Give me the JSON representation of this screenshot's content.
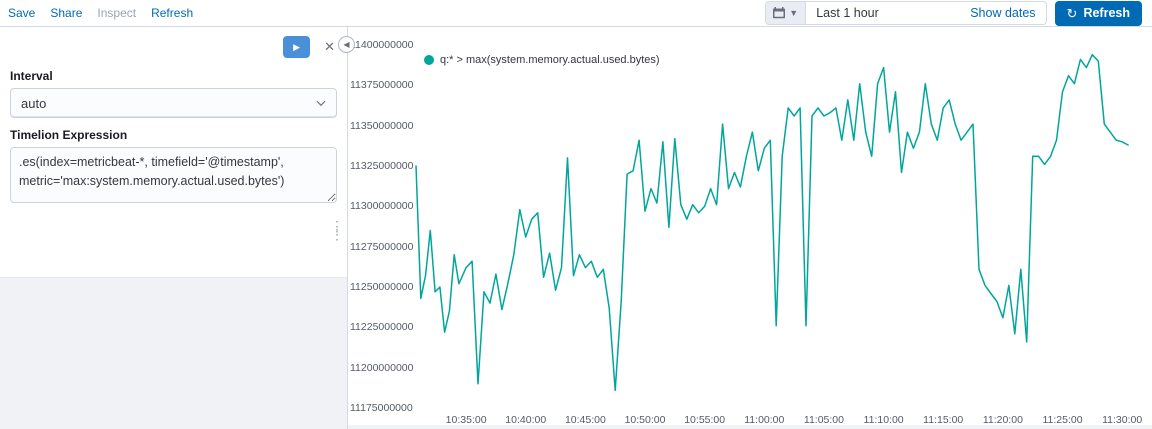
{
  "topbar": {
    "menu": [
      {
        "label": "Save",
        "enabled": true
      },
      {
        "label": "Share",
        "enabled": true
      },
      {
        "label": "Inspect",
        "enabled": false
      },
      {
        "label": "Refresh",
        "enabled": true
      }
    ],
    "time_picker": {
      "range": "Last 1 hour",
      "show_dates": "Show dates",
      "refresh_label": "Refresh"
    }
  },
  "editor": {
    "interval_label": "Interval",
    "interval_value": "auto",
    "expression_label": "Timelion Expression",
    "expression": ".es(index=metricbeat-*, timefield='@timestamp', metric='max:system.memory.actual.used.bytes')"
  },
  "chart_data": {
    "type": "line",
    "title": "",
    "legend": "q:* > max(system.memory.actual.used.bytes)",
    "legend_position": "top-left",
    "series_color": "#00a69b",
    "grid": false,
    "y_unit": "bytes",
    "ylim": [
      11175000000,
      11400000000
    ],
    "y_tick_step": 25000000,
    "x_unit": "minutes after 10:30:00",
    "x_domain_minutes": [
      0.8,
      62
    ],
    "x_tick_minutes": [
      5,
      10,
      15,
      20,
      25,
      30,
      35,
      40,
      45,
      50,
      55,
      60
    ],
    "x_tick_labels": [
      "10:35:00",
      "10:40:00",
      "10:45:00",
      "10:50:00",
      "10:55:00",
      "11:00:00",
      "11:05:00",
      "11:10:00",
      "11:15:00",
      "11:20:00",
      "11:25:00",
      "11:30:00"
    ],
    "x_minutes": [
      0.8,
      1.2,
      1.6,
      2,
      2.4,
      2.8,
      3.2,
      3.6,
      4,
      4.4,
      5,
      5.5,
      6,
      6.5,
      7,
      7.5,
      8,
      8.5,
      9,
      9.5,
      10,
      10.5,
      11,
      11.5,
      12,
      12.5,
      13,
      13.5,
      14,
      14.5,
      15,
      15.5,
      16,
      16.5,
      17,
      17.5,
      18,
      18.5,
      19,
      19.5,
      20,
      20.5,
      21,
      21.5,
      22,
      22.5,
      23,
      23.5,
      24,
      24.5,
      25,
      25.5,
      26,
      26.5,
      27,
      27.5,
      28,
      28.5,
      29,
      29.5,
      30,
      30.5,
      31,
      31.5,
      32,
      32.5,
      33,
      33.5,
      34,
      34.5,
      35,
      35.5,
      36,
      36.5,
      37,
      37.5,
      38,
      38.5,
      39,
      39.5,
      40,
      40.5,
      41,
      41.5,
      42,
      42.5,
      43,
      43.5,
      44,
      44.5,
      45,
      45.5,
      46,
      46.5,
      47,
      47.5,
      48,
      48.5,
      49,
      49.5,
      50,
      50.5,
      51,
      51.5,
      52,
      52.5,
      53,
      53.5,
      54,
      54.5,
      55,
      55.5,
      56,
      56.5,
      57,
      57.5,
      58,
      58.5,
      59,
      59.5,
      60,
      60.5
    ],
    "values": [
      11325000000,
      11243000000,
      11257000000,
      11285000000,
      11247000000,
      11250000000,
      11222000000,
      11235000000,
      11270000000,
      11252000000,
      11262000000,
      11266000000,
      11190000000,
      11247000000,
      11240000000,
      11258000000,
      11236000000,
      11252000000,
      11270000000,
      11298000000,
      11281000000,
      11292000000,
      11296000000,
      11256000000,
      11271000000,
      11248000000,
      11262000000,
      11330000000,
      11257000000,
      11270000000,
      11262000000,
      11266000000,
      11256000000,
      11261000000,
      11237000000,
      11186000000,
      11241000000,
      11320000000,
      11322000000,
      11341000000,
      11297000000,
      11311000000,
      11302000000,
      11340000000,
      11287000000,
      11342000000,
      11301000000,
      11292000000,
      11301000000,
      11296000000,
      11300000000,
      11311000000,
      11301000000,
      11351000000,
      11311000000,
      11321000000,
      11312000000,
      11331000000,
      11346000000,
      11322000000,
      11336000000,
      11341000000,
      11226000000,
      11331000000,
      11361000000,
      11356000000,
      11361000000,
      11226000000,
      11356000000,
      11361000000,
      11356000000,
      11358000000,
      11361000000,
      11341000000,
      11366000000,
      11341000000,
      11376000000,
      11346000000,
      11331000000,
      11376000000,
      11386000000,
      11346000000,
      11371000000,
      11321000000,
      11346000000,
      11336000000,
      11346000000,
      11376000000,
      11351000000,
      11341000000,
      11361000000,
      11366000000,
      11351000000,
      11341000000,
      11346000000,
      11351000000,
      11261000000,
      11251000000,
      11246000000,
      11241000000,
      11231000000,
      11251000000,
      11221000000,
      11261000000,
      11216000000,
      11331000000,
      11331000000,
      11326000000,
      11331000000,
      11341000000,
      11371000000,
      11381000000,
      11376000000,
      11391000000,
      11386000000,
      11394000000,
      11390000000,
      11351000000,
      11346000000,
      11341000000,
      11340000000,
      11338000000
    ]
  }
}
